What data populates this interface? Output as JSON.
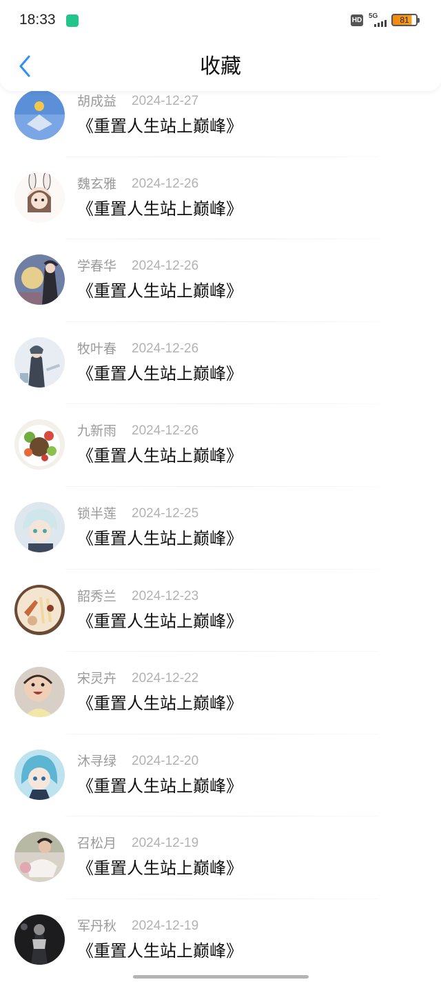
{
  "status": {
    "time": "18:33",
    "hd": "HD",
    "network": "5G",
    "battery": "81",
    "battery_level": 0.81
  },
  "header": {
    "title": "收藏"
  },
  "items": [
    {
      "name": "胡成益",
      "date": "2024-12-27",
      "title": "《重置人生站上巅峰》"
    },
    {
      "name": "魏玄雅",
      "date": "2024-12-26",
      "title": "《重置人生站上巅峰》"
    },
    {
      "name": "学春华",
      "date": "2024-12-26",
      "title": "《重置人生站上巅峰》"
    },
    {
      "name": "牧叶春",
      "date": "2024-12-26",
      "title": "《重置人生站上巅峰》"
    },
    {
      "name": "九新雨",
      "date": "2024-12-26",
      "title": "《重置人生站上巅峰》"
    },
    {
      "name": "锁半莲",
      "date": "2024-12-25",
      "title": "《重置人生站上巅峰》"
    },
    {
      "name": "韶秀兰",
      "date": "2024-12-23",
      "title": "《重置人生站上巅峰》"
    },
    {
      "name": "宋灵卉",
      "date": "2024-12-22",
      "title": "《重置人生站上巅峰》"
    },
    {
      "name": "沐寻绿",
      "date": "2024-12-20",
      "title": "《重置人生站上巅峰》"
    },
    {
      "name": "召松月",
      "date": "2024-12-19",
      "title": "《重置人生站上巅峰》"
    },
    {
      "name": "军丹秋",
      "date": "2024-12-19",
      "title": "《重置人生站上巅峰》"
    }
  ],
  "colors": {
    "accent": "#2f8ff5",
    "name_text": "#9a9a9a",
    "date_text": "#b2b2b2",
    "title_text": "#111111"
  }
}
